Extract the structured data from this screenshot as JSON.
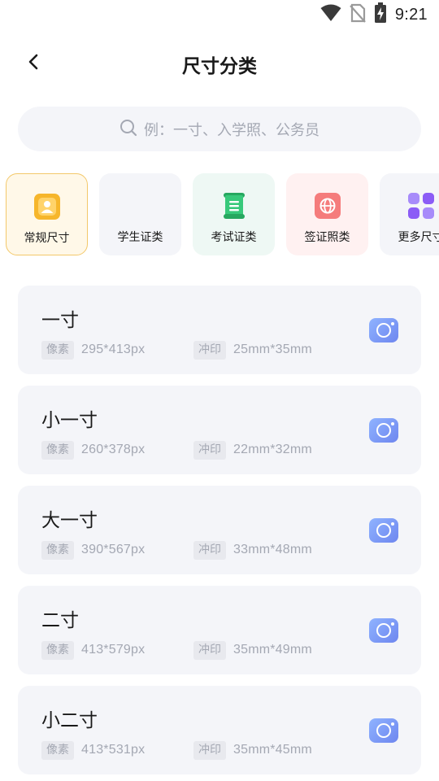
{
  "status_bar": {
    "time": "9:21",
    "icons": [
      "wifi-icon",
      "no-sim-icon",
      "battery-charging-icon"
    ]
  },
  "header": {
    "title": "尺寸分类",
    "back_icon": "chevron-left-icon"
  },
  "search": {
    "placeholder": "例：一寸、入学照、公务员",
    "icon": "search-icon"
  },
  "categories": [
    {
      "label": "常规尺寸",
      "icon": "person-badge-icon",
      "active": true,
      "bg": "#fff8e8",
      "icon_color": "#f6b62b"
    },
    {
      "label": "学生证类",
      "icon": "",
      "active": false,
      "bg": "#f4f5f9"
    },
    {
      "label": "考试证类",
      "icon": "document-list-icon",
      "active": false,
      "bg": "#eef8f4",
      "icon_color": "#2fbe73"
    },
    {
      "label": "签证照类",
      "icon": "globe-icon",
      "active": false,
      "bg": "#fff1f1",
      "icon_color": "#f26d6d"
    },
    {
      "label": "更多尺寸",
      "icon": "grid-icon",
      "active": false,
      "bg": "#f4f5f9",
      "icon_color": "#8a6ff0"
    }
  ],
  "sizes": [
    {
      "name": "一寸",
      "pixel_label": "像素",
      "pixel": "295*413px",
      "print_label": "冲印",
      "print": "25mm*35mm"
    },
    {
      "name": "小一寸",
      "pixel_label": "像素",
      "pixel": "260*378px",
      "print_label": "冲印",
      "print": "22mm*32mm"
    },
    {
      "name": "大一寸",
      "pixel_label": "像素",
      "pixel": "390*567px",
      "print_label": "冲印",
      "print": "33mm*48mm"
    },
    {
      "name": "二寸",
      "pixel_label": "像素",
      "pixel": "413*579px",
      "print_label": "冲印",
      "print": "35mm*49mm"
    },
    {
      "name": "小二寸",
      "pixel_label": "像素",
      "pixel": "413*531px",
      "print_label": "冲印",
      "print": "35mm*45mm"
    }
  ],
  "colors": {
    "accent_yellow": "#f3c86a",
    "camera_blue": "#6e86ef",
    "muted_text": "#a4a8b3",
    "card_bg": "#f4f5f9"
  }
}
